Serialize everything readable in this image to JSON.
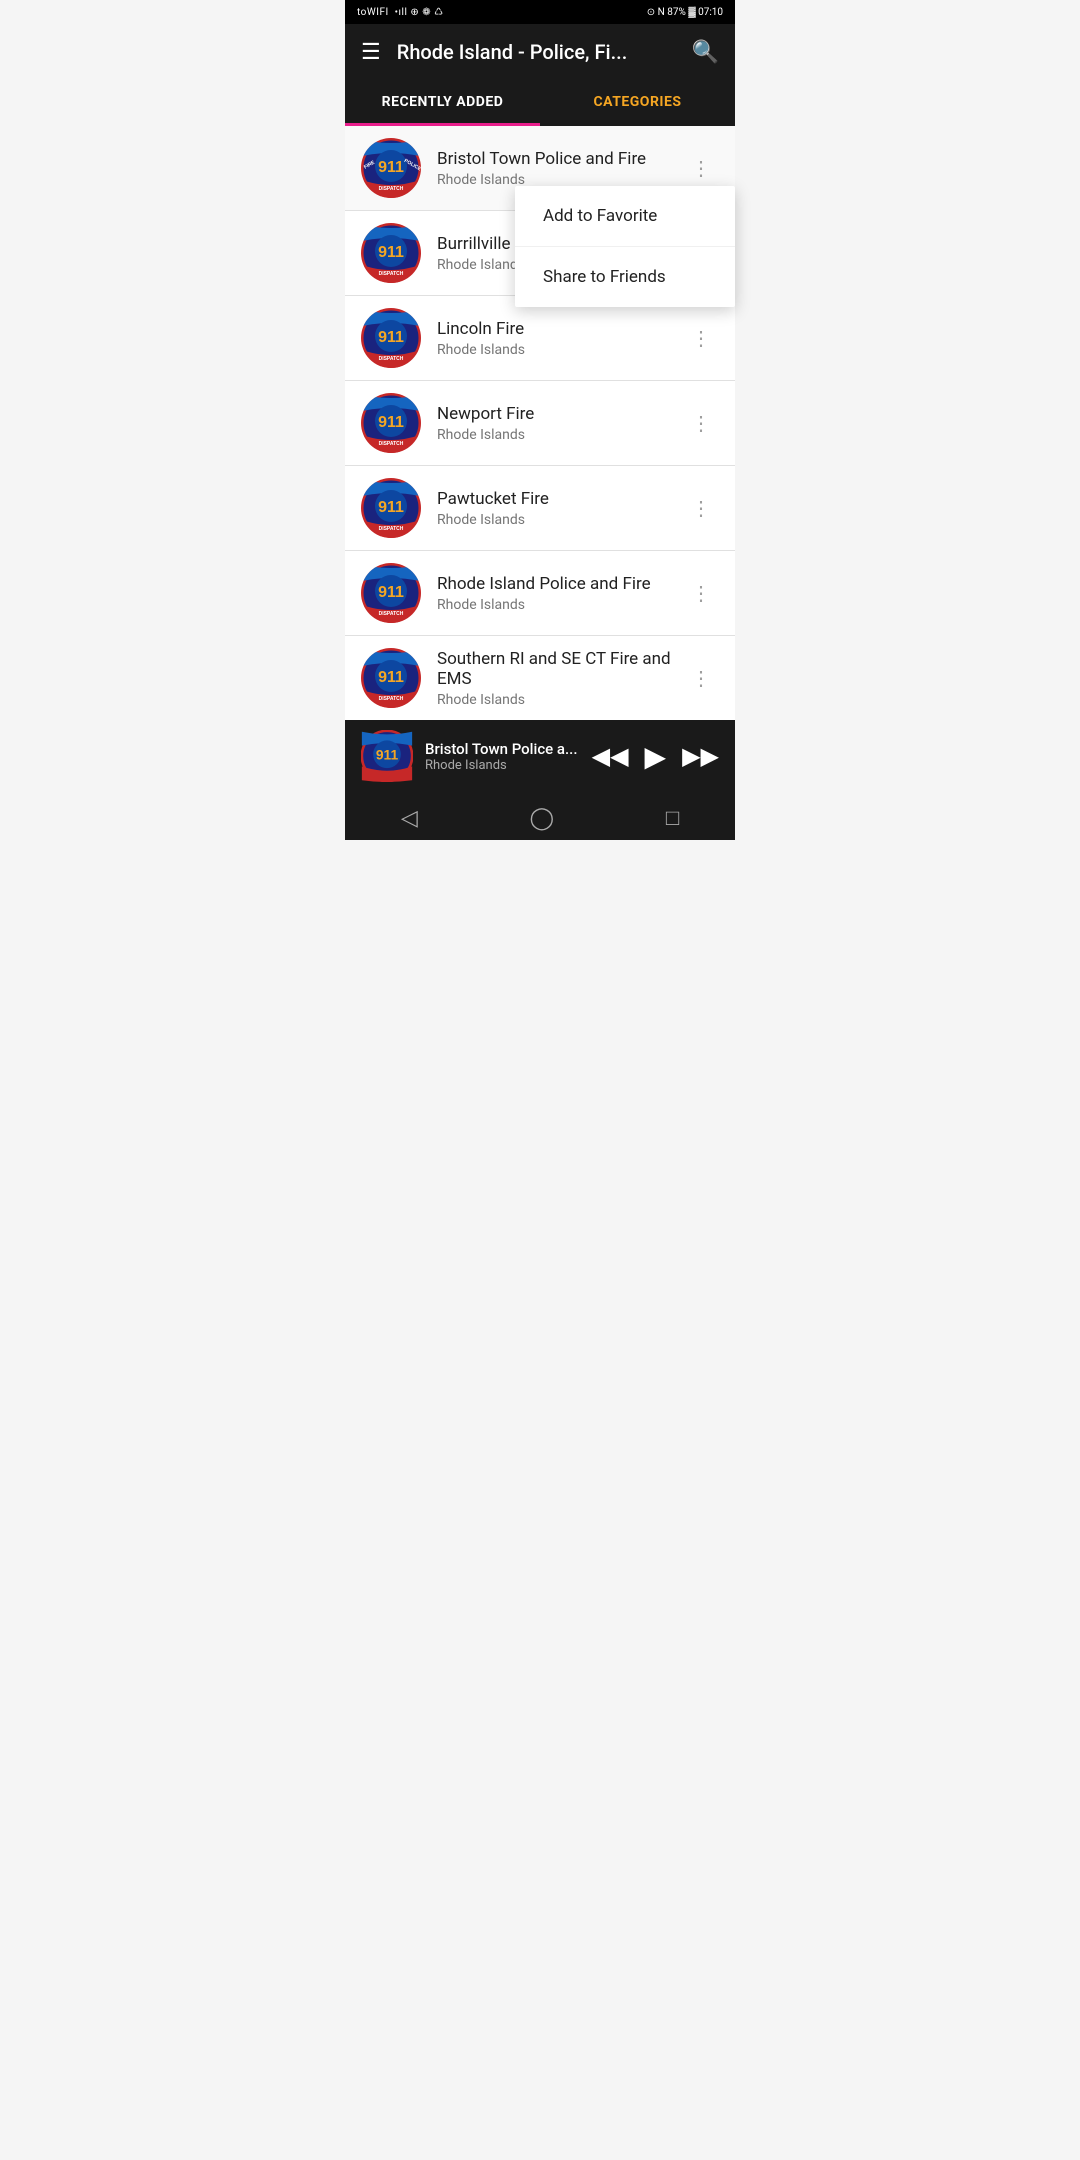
{
  "status_bar": {
    "left": "toWIFI • ••• ☁",
    "right": "⊙ N 87% 🔋 07:10"
  },
  "app_bar": {
    "title": "Rhode Island - Police, Fi...",
    "menu_icon": "☰",
    "search_icon": "🔍"
  },
  "tabs": [
    {
      "id": "recently_added",
      "label": "RECENTLY ADDED",
      "active": true
    },
    {
      "id": "categories",
      "label": "CATEGORIES",
      "active": false
    }
  ],
  "context_menu": {
    "visible": true,
    "anchor_item_index": 0,
    "items": [
      {
        "id": "add_favorite",
        "label": "Add to Favorite"
      },
      {
        "id": "share_friends",
        "label": "Share to Friends"
      }
    ]
  },
  "list_items": [
    {
      "id": 0,
      "title": "Bristol Town Police and Fire",
      "subtitle": "Rhode Islands",
      "has_menu_open": true
    },
    {
      "id": 1,
      "title": "Burrillville Fire a...",
      "subtitle": "Rhode Islands",
      "has_menu_open": false
    },
    {
      "id": 2,
      "title": "Lincoln Fire",
      "subtitle": "Rhode Islands",
      "has_menu_open": false
    },
    {
      "id": 3,
      "title": "Newport Fire",
      "subtitle": "Rhode Islands",
      "has_menu_open": false
    },
    {
      "id": 4,
      "title": "Pawtucket Fire",
      "subtitle": "Rhode Islands",
      "has_menu_open": false
    },
    {
      "id": 5,
      "title": "Rhode Island Police and Fire",
      "subtitle": "Rhode Islands",
      "has_menu_open": false
    },
    {
      "id": 6,
      "title": "Southern RI and SE CT Fire and EMS",
      "subtitle": "Rhode Islands",
      "has_menu_open": false
    }
  ],
  "player": {
    "title": "Bristol Town Police a...",
    "subtitle": "Rhode Islands",
    "prev_icon": "⏮",
    "play_icon": "▶",
    "next_icon": "⏭"
  },
  "nav": {
    "back_icon": "◁",
    "home_icon": "○",
    "recent_icon": "□"
  },
  "colors": {
    "accent_orange": "#f5a623",
    "accent_pink": "#e91e8c",
    "app_bar_bg": "#1a1a1a",
    "tab_active_text": "#ffffff",
    "tab_inactive_text": "#f5a623"
  }
}
